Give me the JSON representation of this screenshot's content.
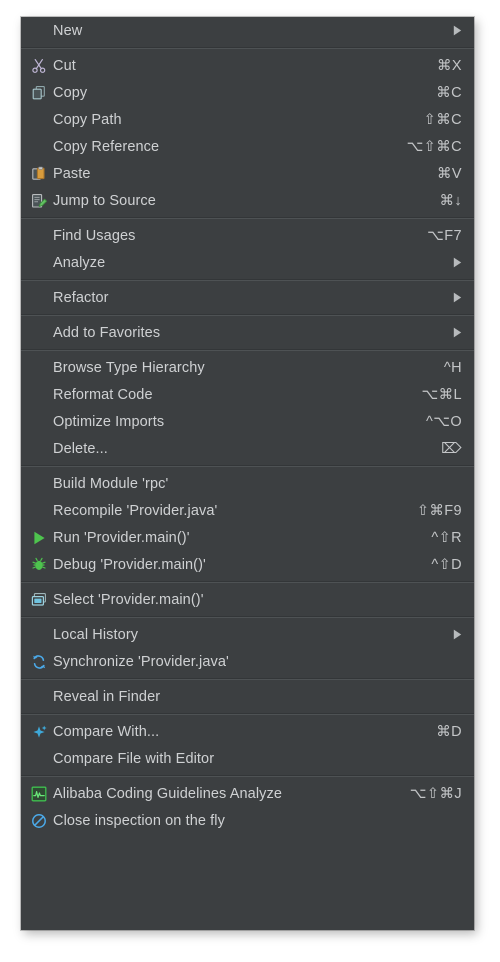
{
  "menu": {
    "type": "context-menu",
    "background_color": "#3c3f41",
    "text_color": "#cfd1d3",
    "separator_color": "#4e5254",
    "groups": [
      {
        "name": "new-group",
        "items": [
          {
            "label": "New",
            "icon": "none",
            "shortcut": "",
            "submenu": true
          }
        ]
      },
      {
        "name": "clipboard-group",
        "items": [
          {
            "label": "Cut",
            "icon": "scissors-icon",
            "shortcut": "⌘X",
            "submenu": false
          },
          {
            "label": "Copy",
            "icon": "copy-icon",
            "shortcut": "⌘C",
            "submenu": false
          },
          {
            "label": "Copy Path",
            "icon": "none",
            "shortcut": "⇧⌘C",
            "submenu": false
          },
          {
            "label": "Copy Reference",
            "icon": "none",
            "shortcut": "⌥⇧⌘C",
            "submenu": false
          },
          {
            "label": "Paste",
            "icon": "paste-icon",
            "shortcut": "⌘V",
            "submenu": false
          },
          {
            "label": "Jump to Source",
            "icon": "jump-to-source-icon",
            "shortcut": "⌘↓",
            "submenu": false
          }
        ]
      },
      {
        "name": "find-group",
        "items": [
          {
            "label": "Find Usages",
            "icon": "none",
            "shortcut": "⌥F7",
            "submenu": false
          },
          {
            "label": "Analyze",
            "icon": "none",
            "shortcut": "",
            "submenu": true
          }
        ]
      },
      {
        "name": "refactor-group",
        "items": [
          {
            "label": "Refactor",
            "icon": "none",
            "shortcut": "",
            "submenu": true
          }
        ]
      },
      {
        "name": "favorites-group",
        "items": [
          {
            "label": "Add to Favorites",
            "icon": "none",
            "shortcut": "",
            "submenu": true
          }
        ]
      },
      {
        "name": "code-group",
        "items": [
          {
            "label": "Browse Type Hierarchy",
            "icon": "none",
            "shortcut": "^H",
            "submenu": false
          },
          {
            "label": "Reformat Code",
            "icon": "none",
            "shortcut": "⌥⌘L",
            "submenu": false
          },
          {
            "label": "Optimize Imports",
            "icon": "none",
            "shortcut": "^⌥O",
            "submenu": false
          },
          {
            "label": "Delete...",
            "icon": "none",
            "shortcut": "⌦",
            "submenu": false
          }
        ]
      },
      {
        "name": "build-run-group",
        "items": [
          {
            "label": "Build Module 'rpc'",
            "icon": "none",
            "shortcut": "",
            "submenu": false
          },
          {
            "label": "Recompile 'Provider.java'",
            "icon": "none",
            "shortcut": "⇧⌘F9",
            "submenu": false
          },
          {
            "label": "Run 'Provider.main()'",
            "icon": "run-icon",
            "shortcut": "^⇧R",
            "submenu": false
          },
          {
            "label": "Debug 'Provider.main()'",
            "icon": "debug-icon",
            "shortcut": "^⇧D",
            "submenu": false
          }
        ]
      },
      {
        "name": "select-group",
        "items": [
          {
            "label": "Select 'Provider.main()'",
            "icon": "select-in-icon",
            "shortcut": "",
            "submenu": false
          }
        ]
      },
      {
        "name": "history-group",
        "items": [
          {
            "label": "Local History",
            "icon": "none",
            "shortcut": "",
            "submenu": true
          },
          {
            "label": "Synchronize 'Provider.java'",
            "icon": "synchronize-icon",
            "shortcut": "",
            "submenu": false
          }
        ]
      },
      {
        "name": "finder-group",
        "items": [
          {
            "label": "Reveal in Finder",
            "icon": "none",
            "shortcut": "",
            "submenu": false
          }
        ]
      },
      {
        "name": "compare-group",
        "items": [
          {
            "label": "Compare With...",
            "icon": "compare-icon",
            "shortcut": "⌘D",
            "submenu": false
          },
          {
            "label": "Compare File with Editor",
            "icon": "none",
            "shortcut": "",
            "submenu": false
          }
        ]
      },
      {
        "name": "inspection-group",
        "items": [
          {
            "label": "Alibaba Coding Guidelines Analyze",
            "icon": "alibaba-analyze-icon",
            "shortcut": "⌥⇧⌘J",
            "submenu": false
          },
          {
            "label": "Close inspection on the fly",
            "icon": "close-inspection-icon",
            "shortcut": "",
            "submenu": false
          }
        ]
      }
    ]
  }
}
